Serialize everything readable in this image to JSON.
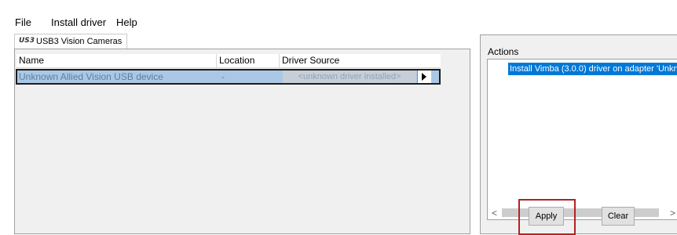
{
  "menu": {
    "file": "File",
    "install_driver": "Install driver",
    "help": "Help"
  },
  "tab": {
    "icon_text": "US3",
    "label": "USB3 Vision Cameras"
  },
  "grid": {
    "columns": {
      "name": "Name",
      "location": "Location",
      "driver_source": "Driver Source"
    },
    "row": {
      "name": "Unknown Allied Vision USB device",
      "location": "-",
      "driver_source": "<unknown driver installed>"
    }
  },
  "actions": {
    "label": "Actions",
    "items": [
      "Install Vimba (3.0.0) driver on adapter 'Unkno"
    ]
  },
  "scrollbar": {
    "left_arrow": "<",
    "right_arrow": ">"
  },
  "buttons": {
    "apply": "Apply",
    "clear": "Clear"
  },
  "colors": {
    "selection": "#0078d7",
    "highlight_border": "#b22222",
    "row_selected": "#aac8e6"
  }
}
